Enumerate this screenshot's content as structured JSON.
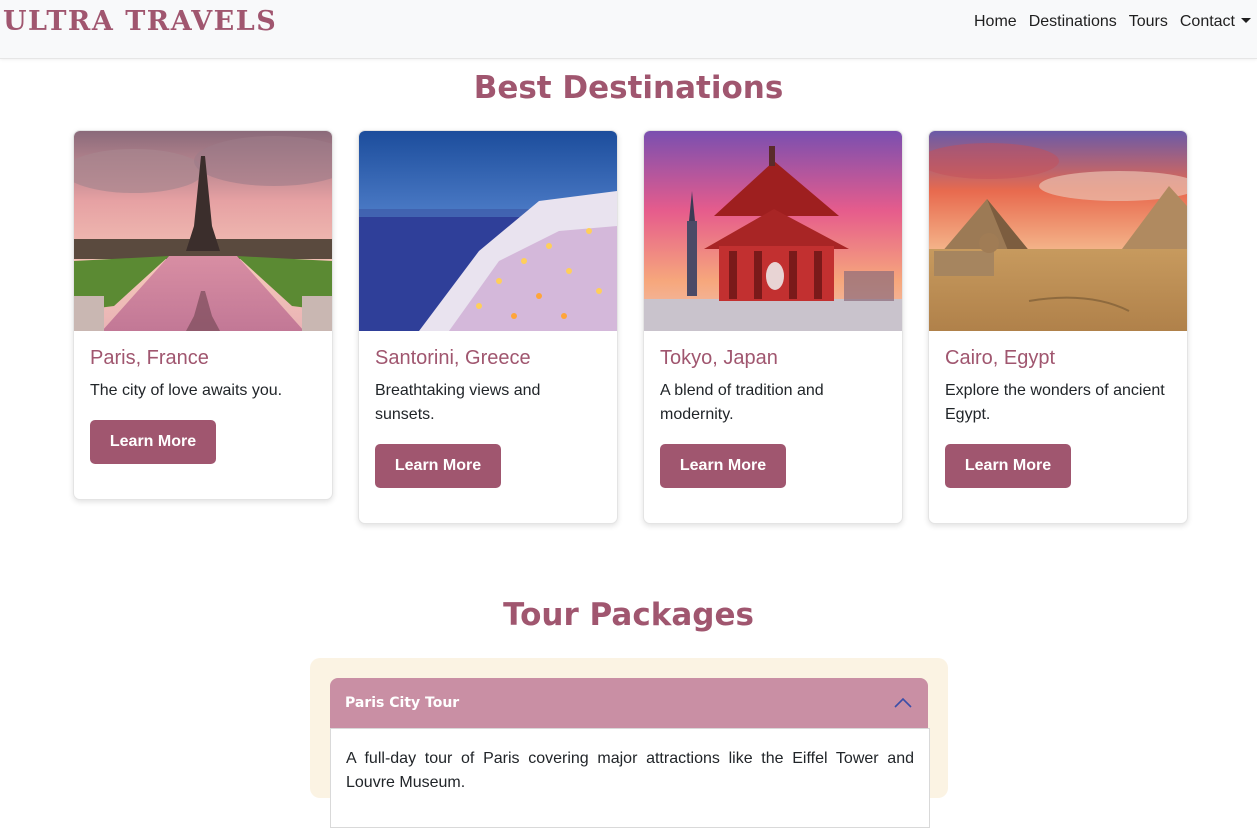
{
  "navbar": {
    "brand": "ULTRA TRAVELS",
    "links": [
      "Home",
      "Destinations",
      "Tours",
      "Contact"
    ]
  },
  "destinations": {
    "title": "Best Destinations",
    "cards": [
      {
        "title": "Paris, France",
        "text": "The city of love awaits you.",
        "button": "Learn More",
        "image": "eiffel-tower-image"
      },
      {
        "title": "Santorini, Greece",
        "text": "Breathtaking views and sunsets.",
        "button": "Learn More",
        "image": "santorini-village-image"
      },
      {
        "title": "Tokyo, Japan",
        "text": "A blend of tradition and modernity.",
        "button": "Learn More",
        "image": "tokyo-temple-image"
      },
      {
        "title": "Cairo, Egypt",
        "text": "Explore the wonders of ancient Egypt.",
        "button": "Learn More",
        "image": "pyramids-image"
      }
    ]
  },
  "tours": {
    "title": "Tour Packages",
    "items": [
      {
        "title": "Paris City Tour",
        "body": "A full-day tour of Paris covering major attractions like the Eiffel Tower and Louvre Museum."
      }
    ]
  },
  "colors": {
    "brand": "#a0566f",
    "accordion_header": "#c98fa4",
    "tour_background": "#fbf3e3",
    "navbar_background": "#f8f9fa"
  }
}
